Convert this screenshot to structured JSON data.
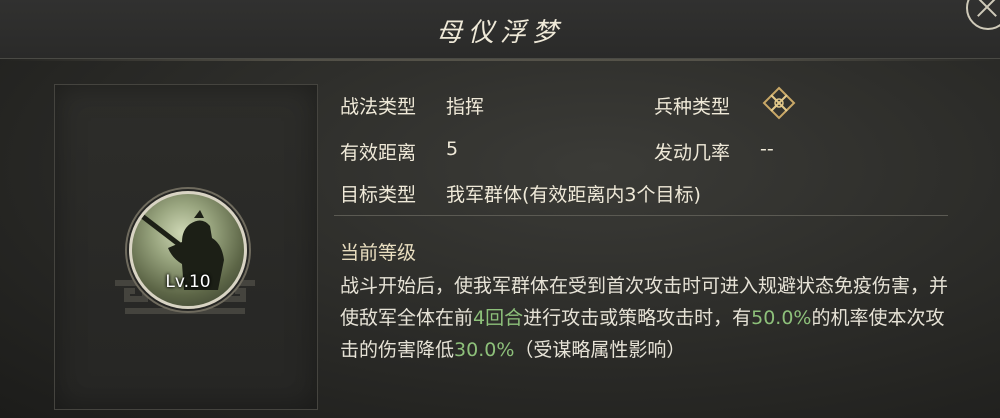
{
  "title": "母仪浮梦",
  "portrait": {
    "level": "Lv.10"
  },
  "info": {
    "type_label": "战法类型",
    "type_value": "指挥",
    "troop_label": "兵种类型",
    "range_label": "有效距离",
    "range_value": "5",
    "rate_label": "发动几率",
    "rate_value": "--",
    "target_label": "目标类型",
    "target_value": "我军群体(有效距离内3个目标)"
  },
  "effect": {
    "section_title": "当前等级",
    "text_1": "战斗开始后，使我军群体在受到首次攻击时可进入规避状态免疫伤害，并使敌军全体在前",
    "highlight_1": "4回合",
    "text_2": "进行攻击或策略攻击时，有",
    "highlight_2": "50.0%",
    "text_3": "的机率使本次攻击的伤害降低",
    "highlight_3": "30.0%",
    "text_4": "（受谋略属性影响）"
  },
  "colors": {
    "highlight": "#8dc07a",
    "text": "#e6e2d6",
    "background": "#2a2a27"
  },
  "icons": {
    "troop_type": "crossed-weapons-diamond-icon",
    "close": "close-icon"
  }
}
